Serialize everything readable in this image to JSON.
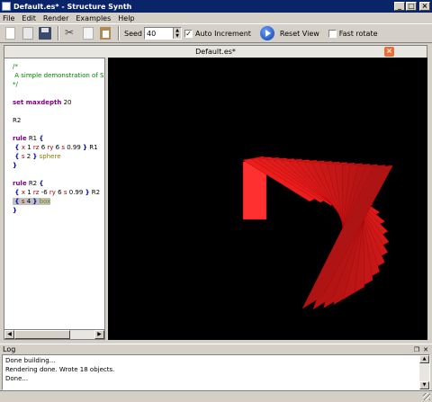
{
  "window": {
    "title": "Default.es* - Structure Synth",
    "min": "_",
    "max": "□",
    "close": "×"
  },
  "menu": [
    "File",
    "Edit",
    "Render",
    "Examples",
    "Help"
  ],
  "toolbar": {
    "seed_label": "Seed",
    "seed_value": "40",
    "auto_increment_label": "Auto Increment",
    "auto_increment_checked": "✓",
    "reset_view_label": "Reset View",
    "fast_rotate_label": "Fast rotate",
    "fast_rotate_checked": ""
  },
  "tab": {
    "label": "Default.es*",
    "close": "×"
  },
  "editor": {
    "lines": [
      [
        {
          "t": "/*",
          "c": "c-comment"
        }
      ],
      [
        {
          "t": " A simple demonstration of Str",
          "c": "c-comment"
        }
      ],
      [
        {
          "t": "*/",
          "c": "c-comment"
        }
      ],
      [],
      [
        {
          "t": "set maxdepth",
          "c": "c-kw"
        },
        {
          "t": " 20",
          "c": "c-num"
        }
      ],
      [],
      [
        {
          "t": "R2",
          "c": "c-num"
        }
      ],
      [],
      [
        {
          "t": "rule",
          "c": "c-kw"
        },
        {
          "t": " R1 ",
          "c": "c-num"
        },
        {
          "t": "{",
          "c": "c-br"
        }
      ],
      [
        {
          "t": " { ",
          "c": "c-br"
        },
        {
          "t": "x",
          "c": "c-trans"
        },
        {
          "t": " 1 ",
          "c": "c-num"
        },
        {
          "t": "rz",
          "c": "c-trans"
        },
        {
          "t": " 6 ",
          "c": "c-num"
        },
        {
          "t": "ry",
          "c": "c-trans"
        },
        {
          "t": " 6 ",
          "c": "c-num"
        },
        {
          "t": "s",
          "c": "c-trans"
        },
        {
          "t": " 0.99 ",
          "c": "c-num"
        },
        {
          "t": "}",
          "c": "c-br"
        },
        {
          "t": " R1",
          "c": "c-num"
        }
      ],
      [
        {
          "t": " { ",
          "c": "c-br"
        },
        {
          "t": "s",
          "c": "c-trans"
        },
        {
          "t": " 2 ",
          "c": "c-num"
        },
        {
          "t": "}",
          "c": "c-br"
        },
        {
          "t": " sphere",
          "c": "c-prim"
        }
      ],
      [
        {
          "t": "}",
          "c": "c-br"
        }
      ],
      [],
      [
        {
          "t": "rule",
          "c": "c-kw"
        },
        {
          "t": " R2 ",
          "c": "c-num"
        },
        {
          "t": "{",
          "c": "c-br"
        }
      ],
      [
        {
          "t": " { ",
          "c": "c-br"
        },
        {
          "t": "x",
          "c": "c-trans"
        },
        {
          "t": " 1 ",
          "c": "c-num"
        },
        {
          "t": "rz",
          "c": "c-trans"
        },
        {
          "t": " -6 ",
          "c": "c-num"
        },
        {
          "t": "ry",
          "c": "c-trans"
        },
        {
          "t": " 6 ",
          "c": "c-num"
        },
        {
          "t": "s",
          "c": "c-trans"
        },
        {
          "t": " 0.99 ",
          "c": "c-num"
        },
        {
          "t": "}",
          "c": "c-br"
        },
        {
          "t": " R2",
          "c": "c-num"
        }
      ],
      [
        {
          "t": " { ",
          "c": "c-br",
          "sel": true
        },
        {
          "t": "s",
          "c": "c-trans",
          "sel": true
        },
        {
          "t": " 4 ",
          "c": "c-num",
          "sel": true
        },
        {
          "t": "}",
          "c": "c-br",
          "sel": true
        },
        {
          "t": " box",
          "c": "c-prim",
          "sel": true
        }
      ],
      [
        {
          "t": "}",
          "c": "c-br"
        }
      ]
    ]
  },
  "scene": {
    "background": "#000000",
    "object_count": 18,
    "primitive": "box",
    "color": "#ff2020"
  },
  "log": {
    "title": "Log",
    "lines": [
      "Done building...",
      "Rendering done. Wrote 18 objects.",
      "Done..."
    ]
  }
}
